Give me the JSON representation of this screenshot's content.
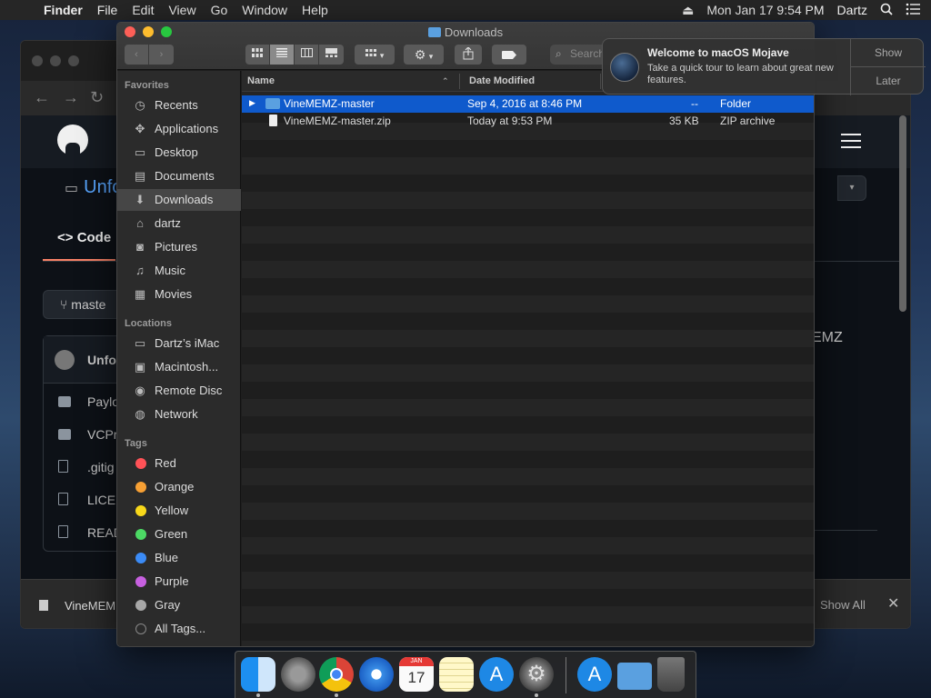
{
  "menubar": {
    "app": "Finder",
    "items": [
      "File",
      "Edit",
      "View",
      "Go",
      "Window",
      "Help"
    ],
    "datetime": "Mon Jan 17  9:54 PM",
    "user": "Dartz"
  },
  "background_browser": {
    "repo_name": "Unfore",
    "code_tab": "Code",
    "branch": "maste",
    "commit_author": "Unfo",
    "files": [
      "Paylo",
      "VCPr",
      ".gitig",
      "LICEI",
      "READ"
    ],
    "readme_snippet": "EMZ",
    "side_letter": "m",
    "download_name": "VineMEM",
    "show_all": "Show All",
    "close_glyph": "✕"
  },
  "finder": {
    "title": "Downloads",
    "search_placeholder": "Search",
    "columns": {
      "name": "Name",
      "date": "Date Modified"
    },
    "files": [
      {
        "name": "VineMEMZ-master",
        "date": "Sep 4, 2016 at 8:46 PM",
        "size": "--",
        "kind": "Folder",
        "selected": true
      },
      {
        "name": "VineMEMZ-master.zip",
        "date": "Today at 9:53 PM",
        "size": "35 KB",
        "kind": "ZIP archive",
        "selected": false
      }
    ],
    "sidebar": {
      "favorites_header": "Favorites",
      "favorites": [
        {
          "label": "Recents",
          "icon": "clock-icon"
        },
        {
          "label": "Applications",
          "icon": "applications-icon"
        },
        {
          "label": "Desktop",
          "icon": "desktop-icon"
        },
        {
          "label": "Documents",
          "icon": "documents-icon"
        },
        {
          "label": "Downloads",
          "icon": "downloads-icon",
          "selected": true
        },
        {
          "label": "dartz",
          "icon": "home-icon"
        },
        {
          "label": "Pictures",
          "icon": "camera-icon"
        },
        {
          "label": "Music",
          "icon": "music-icon"
        },
        {
          "label": "Movies",
          "icon": "film-icon"
        }
      ],
      "locations_header": "Locations",
      "locations": [
        {
          "label": "Dartz’s iMac",
          "icon": "imac-icon"
        },
        {
          "label": "Macintosh...",
          "icon": "hard-drive-icon"
        },
        {
          "label": "Remote Disc",
          "icon": "disc-icon"
        },
        {
          "label": "Network",
          "icon": "globe-icon"
        }
      ],
      "tags_header": "Tags",
      "tags": [
        {
          "label": "Red",
          "color": "#ff5257"
        },
        {
          "label": "Orange",
          "color": "#f7a034"
        },
        {
          "label": "Yellow",
          "color": "#f8d81a"
        },
        {
          "label": "Green",
          "color": "#4cd964"
        },
        {
          "label": "Blue",
          "color": "#3b8bf6"
        },
        {
          "label": "Purple",
          "color": "#c760e0"
        },
        {
          "label": "Gray",
          "color": "#a8a8a8"
        }
      ],
      "all_tags": "All Tags..."
    }
  },
  "notification": {
    "title": "Welcome to macOS Mojave",
    "body": "Take a quick tour to learn about great new features.",
    "show_label": "Show",
    "later_label": "Later"
  },
  "dock": {
    "apps": [
      "Finder",
      "Launchpad",
      "Chrome",
      "Safari",
      "Calendar",
      "Notes",
      "App Store",
      "System Preferences",
      "App Store",
      "Folder",
      "Trash"
    ],
    "calendar_month": "JAN",
    "calendar_day": "17"
  }
}
